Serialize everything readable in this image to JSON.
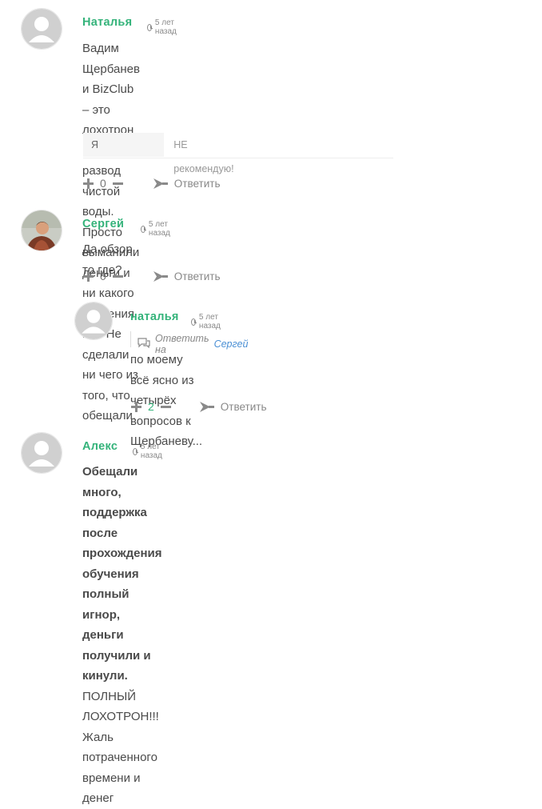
{
  "comments": [
    {
      "author": "Наталья",
      "date": "5 лет назад",
      "lines": [
        "Вадим Щербанев и BizClub – это лохотрон и",
        "развод чистой воды. Просто выманили",
        "деньги и ни какого обучения нет. Не сделали",
        "ни чего из того, что обещали."
      ],
      "rating_label": "Я",
      "rating_value": "НЕ рекомендую!",
      "votes": "0",
      "reply_label": "Ответить"
    },
    {
      "author": "Сергей",
      "date": "5 лет назад",
      "lines": [
        "Да,обзор то где?"
      ],
      "votes": "0",
      "reply_label": "Ответить"
    },
    {
      "author": "наталья",
      "date": "5 лет назад",
      "reply_to_prefix": "Ответить на",
      "reply_to_name": "Сергей",
      "lines": [
        "по моему всё ясно из четырёх",
        "вопросов к Щербаневу..."
      ],
      "votes": "2",
      "reply_label": "Ответить"
    },
    {
      "author": "Алекс",
      "date": "5 лет назад",
      "bold_lines": [
        "Обещали много, поддержка после",
        "прохождения обучения полный игнор,",
        "деньги получили и кинули."
      ],
      "tail_first": "ПОЛНЫЙ",
      "lines_after": [
        "ЛОХОТРОН!!! Жаль потраченного времени и",
        "денег"
      ]
    }
  ],
  "colors": {
    "author": "#34b37a",
    "reply_target": "#4a8fd4",
    "vote_positive": "#34b37a"
  },
  "icons": [
    "default-avatar-icon",
    "user-photo-avatar",
    "clock-icon",
    "plus-icon",
    "minus-icon",
    "reply-arrow-icon",
    "quote-reply-icon"
  ]
}
